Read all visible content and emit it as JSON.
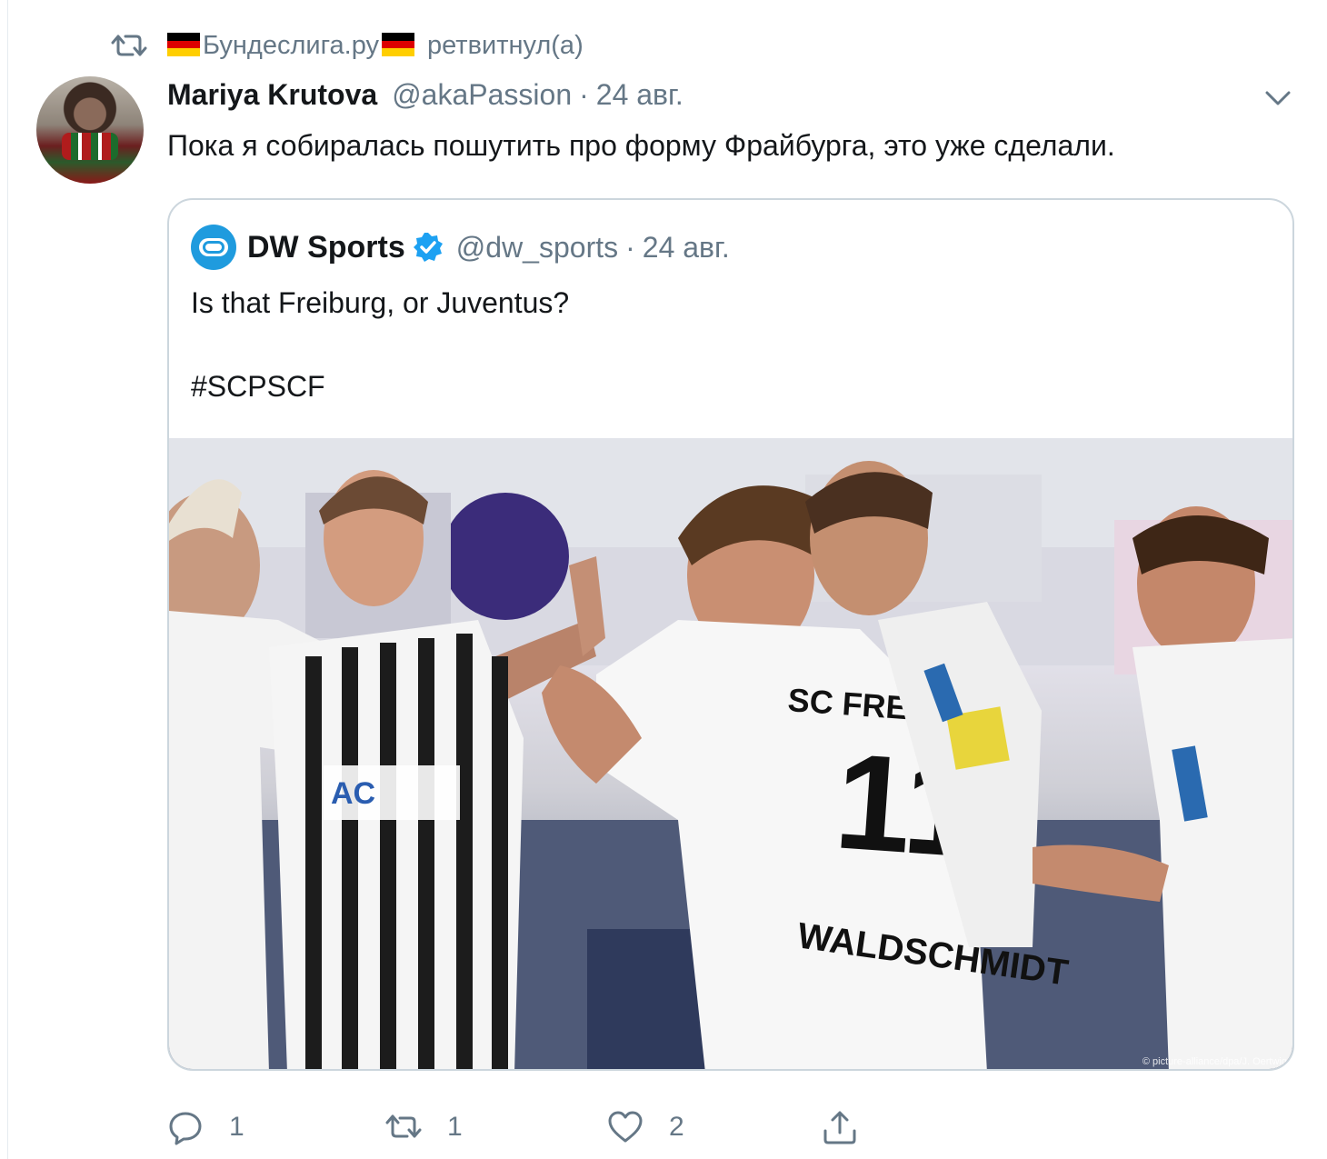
{
  "retweet_context": {
    "retweeter": "Бундеслига.ру",
    "verb": "ретвитнул(а)",
    "icon": "retweet-icon",
    "flag_colors": [
      "#000000",
      "#dd0000",
      "#ffce00"
    ]
  },
  "tweet": {
    "author_name": "Mariya Krutova",
    "author_handle": "@akaPassion",
    "separator": "·",
    "date": "24 авг.",
    "text": "Пока я собиралась пошутить про форму Фрайбурга, это уже сделали.",
    "menu_icon": "chevron-down-icon"
  },
  "quoted_tweet": {
    "author_name": "DW Sports",
    "verified": true,
    "author_handle": "@dw_sports",
    "separator": "·",
    "date": "24 авг.",
    "text": "Is that Freiburg, or Juventus?\n\n#SCPSCF",
    "media_alt": "SC Freiburg players celebrating",
    "media_credit": "© picture-alliance/dpa/J. Oertwig",
    "accent": "#1da1f2"
  },
  "actions": {
    "reply_count": "1",
    "retweet_count": "1",
    "like_count": "2",
    "share_icon": "share-icon"
  },
  "colors": {
    "text": "#14171a",
    "muted": "#657786",
    "border": "#ccd6dd"
  }
}
